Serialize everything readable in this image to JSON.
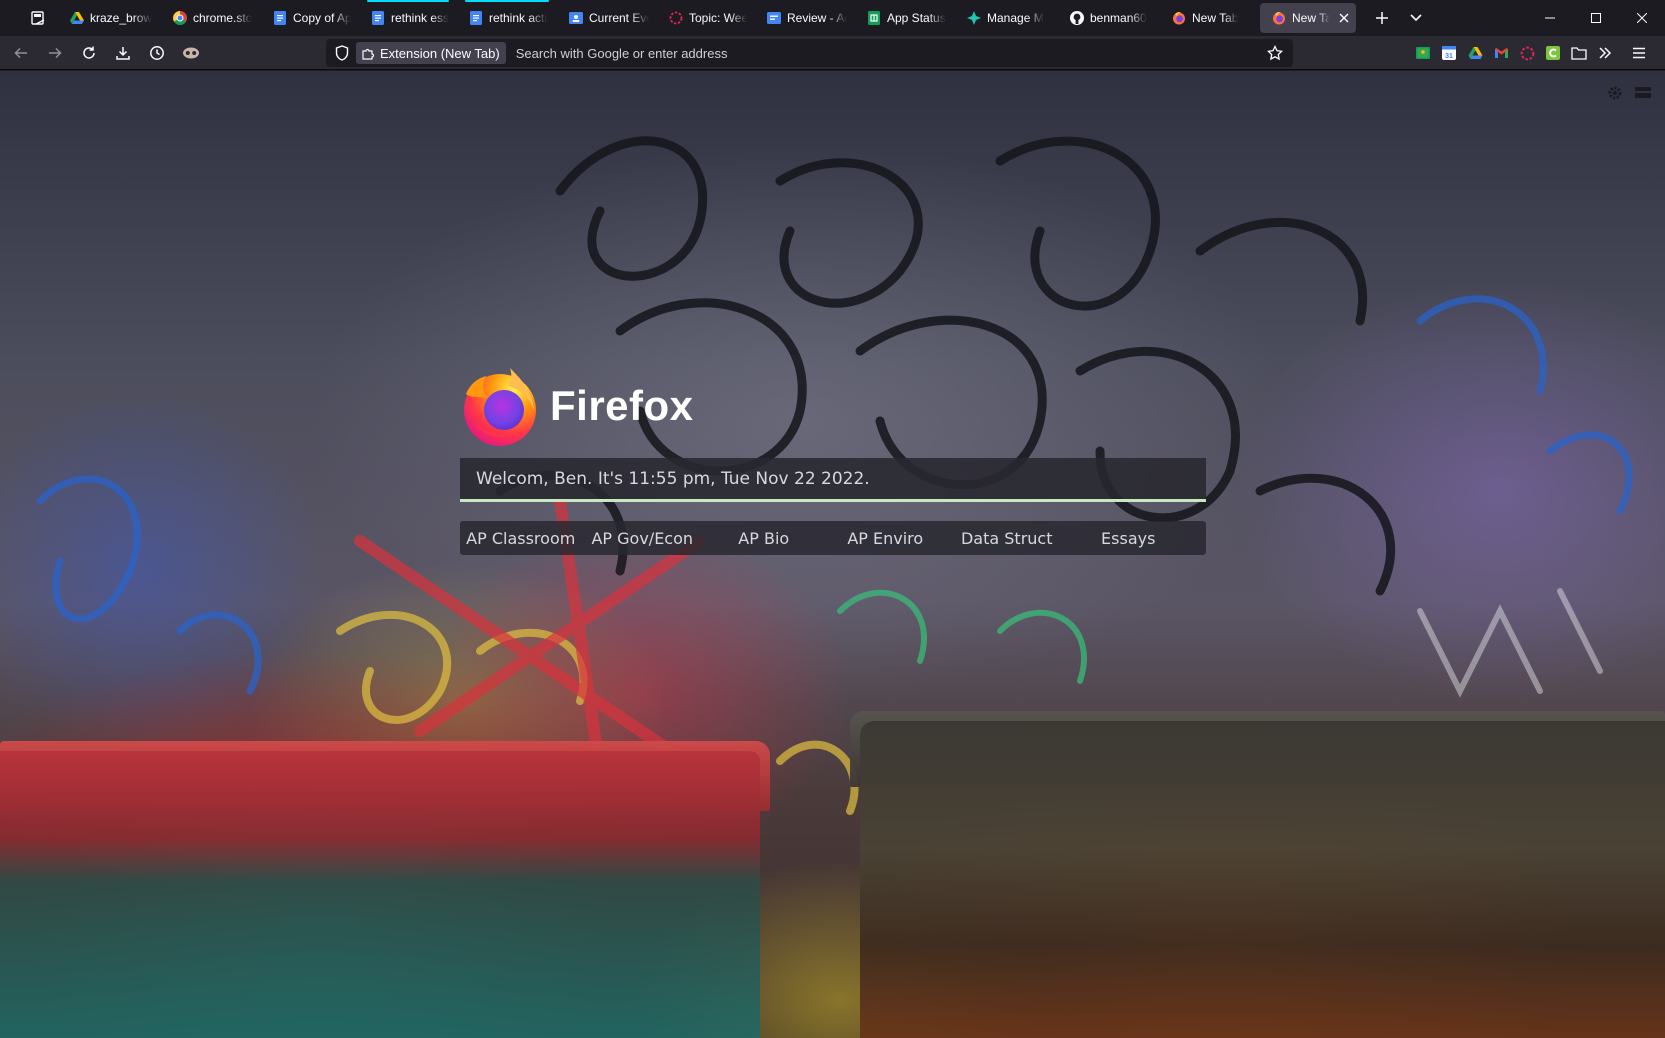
{
  "tabs": [
    {
      "label": "kraze_brow",
      "icon": "google-drive-icon",
      "playing": false
    },
    {
      "label": "chrome.sto",
      "icon": "chrome-icon",
      "playing": false
    },
    {
      "label": "Copy of Ap",
      "icon": "google-docs-icon",
      "playing": false
    },
    {
      "label": "rethink ess",
      "icon": "google-docs-icon",
      "playing": true
    },
    {
      "label": "rethink acti",
      "icon": "google-docs-icon",
      "playing": true
    },
    {
      "label": "Current Eve",
      "icon": "google-classroom-icon",
      "playing": false
    },
    {
      "label": "Topic: Weel",
      "icon": "loading-ring-icon",
      "playing": false
    },
    {
      "label": "Review - Ac",
      "icon": "google-forms-icon",
      "playing": false
    },
    {
      "label": "App Status",
      "icon": "google-sheets-icon",
      "playing": false
    },
    {
      "label": "Manage M",
      "icon": "puzzle-star-icon",
      "playing": false
    },
    {
      "label": "benman60",
      "icon": "github-icon",
      "playing": false
    },
    {
      "label": "New Tab",
      "icon": "firefox-icon",
      "playing": false
    },
    {
      "label": "New Tab",
      "icon": "firefox-icon",
      "playing": false,
      "selected": true
    }
  ],
  "urlbar": {
    "chip_label": "Extension (New Tab)",
    "placeholder": "Search with Google or enter address"
  },
  "extension_icons": [
    "google-classroom-ext-icon",
    "google-calendar-ext-icon",
    "google-drive-ext-icon",
    "gmail-ext-icon",
    "red-ring-ext-icon",
    "green-c-ext-icon",
    "folder-icon",
    "overflow-chevron-icon",
    "hamburger-menu-icon"
  ],
  "startpage": {
    "brand": "Firefox",
    "welcome": "Welcom, Ben. It's 11:55 pm, Tue Nov 22 2022.",
    "links": [
      "AP Classroom",
      "AP Gov/Econ",
      "AP Bio",
      "AP Enviro",
      "Data Struct",
      "Essays"
    ]
  },
  "colors": {
    "toolbar": "#2b2a33",
    "tabstrip": "#1c1b22",
    "selected_tab": "#42414d",
    "welcome_underline": "#c6e9c2",
    "playing_indicator": "#00ddff"
  }
}
